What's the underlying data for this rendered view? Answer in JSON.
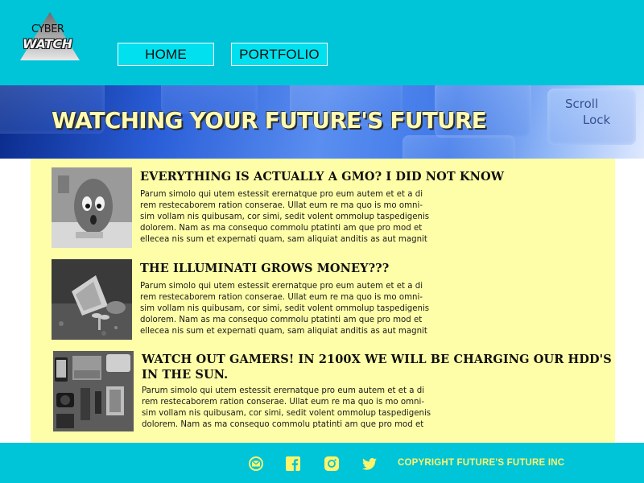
{
  "brand": {
    "logo_line1": "CYBER",
    "logo_line2": "WATCH"
  },
  "nav": {
    "home": "HOME",
    "portfolio": "PORTFOLIO"
  },
  "hero": {
    "title": "WATCHING YOUR FUTURE'S FUTURE",
    "keys": [
      "Scroll",
      "Lock"
    ]
  },
  "articles": [
    {
      "title": "EVERYTHING IS ACTUALLY A GMO? I DID NOT KNOW",
      "image": "potato-face-image",
      "body": [
        "Parum simolo qui utem estessit erernatque pro eum autem et et a di",
        "rem restecaborem ration conserae. Ullat eum re ma quo is mo omni-",
        "sim vollam nis quibusam, cor simi, sedit volent ommolup taspedigenis",
        "dolorem. Nam as ma consequo commolu ptatinti am que pro mod et",
        "ellecea nis sum et expernati quam, sam aliquiat anditis as aut magnit"
      ]
    },
    {
      "title": "THE ILLUMINATI GROWS MONEY???",
      "image": "money-plant-image",
      "body": [
        "Parum simolo qui utem estessit erernatque pro eum autem et et a di",
        "rem restecaborem ration conserae. Ullat eum re ma quo is mo omni-",
        "sim vollam nis quibusam, cor simi, sedit volent ommolup taspedigenis",
        "dolorem. Nam as ma consequo commolu ptatinti am que pro mod et",
        "ellecea nis sum et expernati quam, sam aliquiat anditis as aut magnit"
      ]
    },
    {
      "title_line1": "WATCH OUT GAMERS! IN 2100X WE WILL BE CHARGING OUR HDD'S",
      "title_line2": "IN THE SUN.",
      "image": "gadgets-flatlay-image",
      "body": [
        "Parum simolo qui utem estessit erernatque pro eum autem et et a di",
        "rem restecaborem ration conserae. Ullat eum re ma quo is mo omni-",
        "sim vollam nis quibusam, cor simi, sedit volent ommolup taspedigenis",
        "dolorem. Nam as ma consequo commolu ptatinti am que pro mod et"
      ]
    }
  ],
  "footer": {
    "icons": [
      "mail-icon",
      "facebook-icon",
      "instagram-icon",
      "twitter-icon"
    ],
    "copyright": "COPYRIGHT FUTURE'S FUTURE INC"
  },
  "colors": {
    "header_bg": "#00c4d8",
    "content_bg": "#fffea8",
    "nav_button_bg": "#00e0ee",
    "title_yellow": "#fffbb0",
    "footer_text": "#fff46a"
  }
}
